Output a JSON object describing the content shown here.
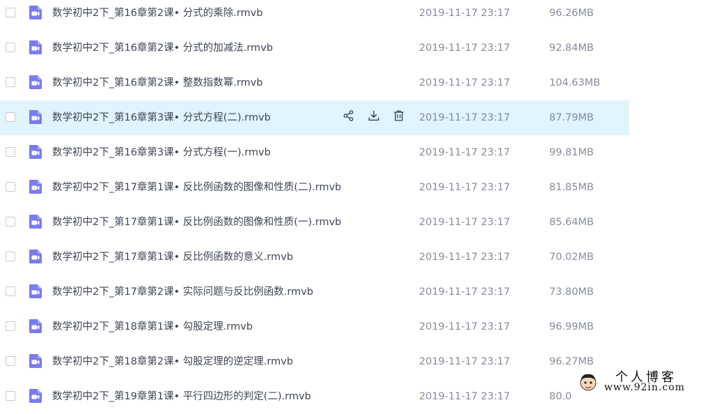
{
  "files": [
    {
      "name": "数学初中2下_第16章第2课• 分式的乘除.rmvb",
      "date": "2019-11-17 23:17",
      "size": "96.26MB",
      "hover": false
    },
    {
      "name": "数学初中2下_第16章第2课• 分式的加减法.rmvb",
      "date": "2019-11-17 23:17",
      "size": "92.84MB",
      "hover": false
    },
    {
      "name": "数学初中2下_第16章第2课• 整数指数幂.rmvb",
      "date": "2019-11-17 23:17",
      "size": "104.63MB",
      "hover": false
    },
    {
      "name": "数学初中2下_第16章第3课• 分式方程(二).rmvb",
      "date": "2019-11-17 23:17",
      "size": "87.79MB",
      "hover": true
    },
    {
      "name": "数学初中2下_第16章第3课• 分式方程(一).rmvb",
      "date": "2019-11-17 23:17",
      "size": "99.81MB",
      "hover": false
    },
    {
      "name": "数学初中2下_第17章第1课• 反比例函数的图像和性质(二).rmvb",
      "date": "2019-11-17 23:17",
      "size": "81.85MB",
      "hover": false
    },
    {
      "name": "数学初中2下_第17章第1课• 反比例函数的图像和性质(一).rmvb",
      "date": "2019-11-17 23:17",
      "size": "85.64MB",
      "hover": false
    },
    {
      "name": "数学初中2下_第17章第1课• 反比例函数的意义.rmvb",
      "date": "2019-11-17 23:17",
      "size": "70.02MB",
      "hover": false
    },
    {
      "name": "数学初中2下_第17章第2课• 实际问题与反比例函数.rmvb",
      "date": "2019-11-17 23:17",
      "size": "73.80MB",
      "hover": false
    },
    {
      "name": "数学初中2下_第18章第1课• 勾股定理.rmvb",
      "date": "2019-11-17 23:17",
      "size": "96.99MB",
      "hover": false
    },
    {
      "name": "数学初中2下_第18章第2课• 勾股定理的逆定理.rmvb",
      "date": "2019-11-17 23:17",
      "size": "96.27MB",
      "hover": false
    },
    {
      "name": "数学初中2下_第19章第1课• 平行四边形的判定(二).rmvb",
      "date": "2019-11-17 23:17",
      "size": "80.0",
      "hover": false
    }
  ],
  "row_actions": [
    "share-icon",
    "download-icon",
    "delete-icon"
  ],
  "watermark": {
    "title": "个人博客",
    "url": "www.92in.com"
  },
  "colors": {
    "icon_purple": "#7b7bf0",
    "hover_bg": "#dff4fc"
  }
}
